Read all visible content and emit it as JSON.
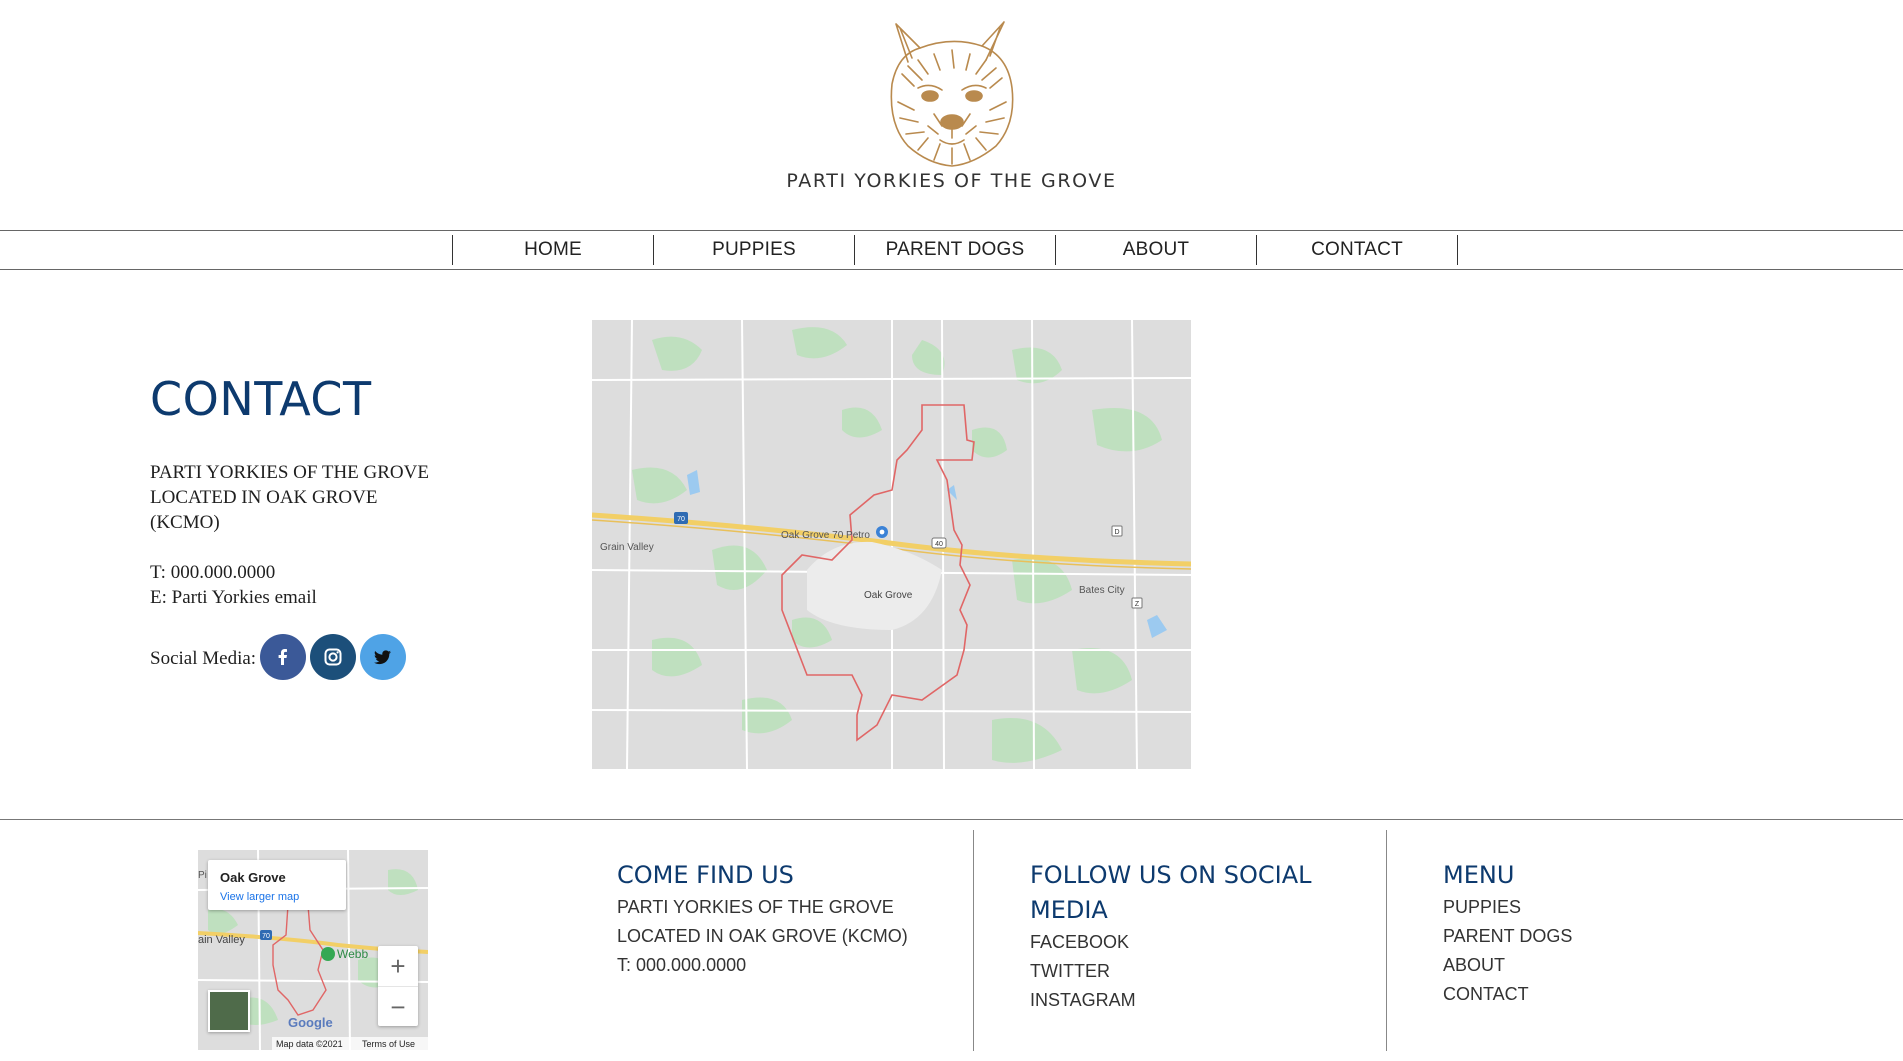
{
  "header": {
    "brand": "PARTI YORKIES OF THE GROVE",
    "logo_icon": "yorkie-dog-face-logo",
    "logo_color": "#b98a4e"
  },
  "nav": {
    "items": [
      {
        "label": "HOME"
      },
      {
        "label": "PUPPIES"
      },
      {
        "label": "PARENT DOGS"
      },
      {
        "label": "ABOUT"
      },
      {
        "label": "CONTACT"
      }
    ]
  },
  "contact": {
    "title": "CONTACT",
    "address_line1": "PARTI YORKIES OF THE GROVE",
    "address_line2": "LOCATED IN OAK GROVE",
    "address_line3": "(KCMO)",
    "phone": "T: 000.000.0000",
    "email": "E: Parti Yorkies email",
    "social_label": "Social Media:",
    "social": {
      "facebook_icon": "facebook-icon",
      "instagram_icon": "instagram-icon",
      "twitter_icon": "twitter-icon",
      "facebook_color": "#3b5998",
      "instagram_color": "#1c4f7a",
      "twitter_color": "#4fa3e6"
    }
  },
  "map": {
    "labels": {
      "oak_grove": "Oak Grove",
      "oak_grove_petro": "Oak Grove 70 Petro",
      "grain_valley": "Grain Valley",
      "bates_city": "Bates City",
      "shield_70": "70",
      "shield_40": "40",
      "shield_d": "D",
      "shield_z": "Z"
    }
  },
  "mini_map": {
    "place": "Oak Grove",
    "view_larger": "View larger map",
    "grain_valley": "ain Valley",
    "webb": "Webb",
    "left_edge": "Pi",
    "shield_70": "70",
    "zoom_in": "+",
    "zoom_out": "−",
    "google": "Google",
    "map_data": "Map data ©2021",
    "terms": "Terms of Use"
  },
  "footer": {
    "find_us": {
      "title": "COME FIND US",
      "line1": "PARTI YORKIES OF THE GROVE",
      "line2": "LOCATED IN OAK GROVE (KCMO)",
      "line3": "T: 000.000.0000"
    },
    "social": {
      "title_line1": "FOLLOW US ON SOCIAL",
      "title_line2": "MEDIA",
      "items": [
        {
          "label": "FACEBOOK"
        },
        {
          "label": "TWITTER"
        },
        {
          "label": "INSTAGRAM"
        }
      ]
    },
    "menu": {
      "title": "MENU",
      "items": [
        {
          "label": "PUPPIES"
        },
        {
          "label": "PARENT DOGS"
        },
        {
          "label": "ABOUT"
        },
        {
          "label": "CONTACT"
        }
      ]
    }
  }
}
